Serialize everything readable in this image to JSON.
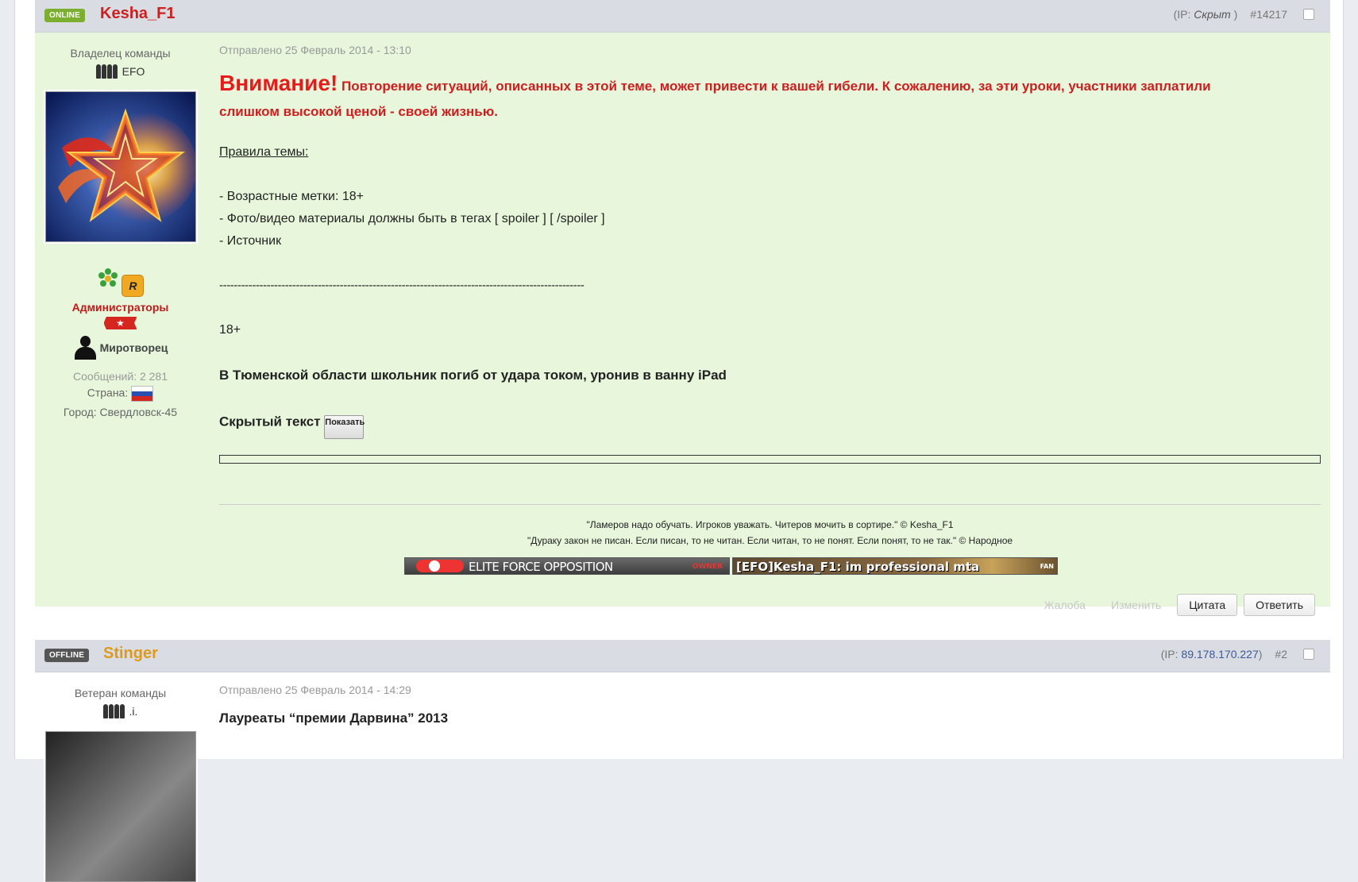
{
  "posts": [
    {
      "status": "ONLINE",
      "username": "Kesha_F1",
      "username_color": "#cc1f1f",
      "ip_prefix": "(IP:",
      "ip_value": "Скрыт",
      "ip_suffix": ")",
      "post_number": "#14217",
      "author": {
        "title": "Владелец команды",
        "team": "EFO",
        "group": "Администраторы",
        "group_color": "#c11a1a",
        "rank": "Миротворец",
        "posts_label": "Сообщений: 2 281",
        "country_label": "Страна:",
        "city_label": "Город: Свердловск-45",
        "icons": [
          "icq-icon",
          "rockstar-icon"
        ]
      },
      "posted": "Отправлено 25 Февраль 2014 - 13:10",
      "warning_big": "Внимание!",
      "warning_text": " Повторение ситуаций, описанных в этой теме, может привести к вашей гибели. К сожалению, за эти уроки, участники заплатили слишком высокой ценой - своей жизнью.",
      "rules_heading": "Правила темы:",
      "rules": [
        "- Возрастные метки: 18+",
        "- Фото/видео материалы должны быть в тегах [ spoiler ] [ /spoiler ]",
        "- Источник"
      ],
      "divider": "----------------------------------------------------------------------------------------------------",
      "age": "18+",
      "headline": "В Тюменской области школьник погиб от удара током, уронив в ванну iPad",
      "spoiler_label": "Скрытый текст",
      "spoiler_button": "Показать",
      "sig_line1": "\"Ламеров надо обучать. Игроков уважать. Читеров мочить в сортире.\" © Kesha_F1",
      "sig_line2": "\"Дураку закон не писан. Если писан, то не читан. Если читан, то не понят. Если понят, то не так.\" © Народное",
      "userbar1": "ELITE FORCE OPPOSITION",
      "userbar1_tag": "OWNER",
      "userbar2": "[EFO]Kesha_F1: im professional mta",
      "userbar2_tag": "FAN",
      "actions": {
        "report": "Жалоба",
        "edit": "Изменить",
        "quote": "Цитата",
        "reply": "Ответить"
      }
    },
    {
      "status": "OFFLINE",
      "username": "Stinger",
      "username_color": "#e09a1a",
      "ip_prefix": "(IP:",
      "ip_value": "89.178.170.227",
      "ip_suffix": ")",
      "post_number": "#2",
      "author": {
        "title": "Ветеран команды",
        "team": ".i."
      },
      "posted": "Отправлено 25 Февраль 2014 - 14:29",
      "headline": "Лауреаты “премии Дарвина” 2013"
    }
  ],
  "colors": {
    "post_bg_highlight": "#e8f7dc",
    "header_bg": "#d9dde3"
  }
}
